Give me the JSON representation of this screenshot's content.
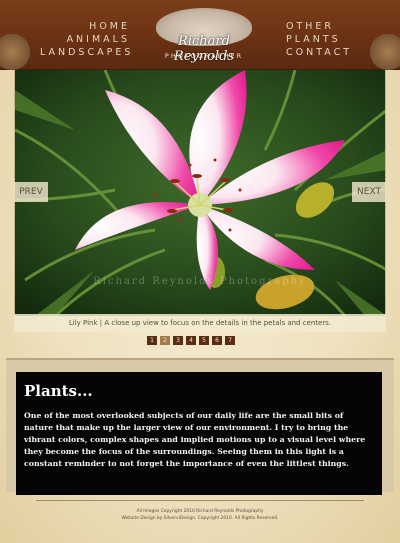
{
  "nav": {
    "left": [
      "HOME",
      "ANIMALS",
      "LANDSCAPES"
    ],
    "right": [
      "OTHER",
      "PLANTS",
      "CONTACT"
    ]
  },
  "logo": {
    "name": "Richard Reynolds",
    "subtitle": "PHOTOGRAPHER"
  },
  "slideshow": {
    "prev_label": "PREV",
    "next_label": "NEXT",
    "watermark": "Richard Reynolds Photography",
    "caption": "Lily Pink | A close up view to focus on the details in the petals and centers.",
    "pages": [
      "1",
      "2",
      "3",
      "4",
      "5",
      "6",
      "7"
    ],
    "active_page": "2"
  },
  "content": {
    "heading": "Plants...",
    "body": "One of the most overlooked subjects of our daily life are the small bits of nature that make up the larger view of our environment. I try to bring the vibrant colors, complex shapes and implied motions up to a visual level where they become the focus of the surroundings. Seeing them in this light is a constant reminder to not forget the importance of even the littlest things."
  },
  "footer": {
    "line1": "All Images Copyright 2010 Richard Reynolds Photography",
    "line2": "Website Design by SilverviDesign. Copyright 2010. All Rights Reserved."
  },
  "colors": {
    "header": "#6b3213",
    "panel": "#050505",
    "pager_active": "#a27a4d",
    "pager": "#5a2c12"
  }
}
